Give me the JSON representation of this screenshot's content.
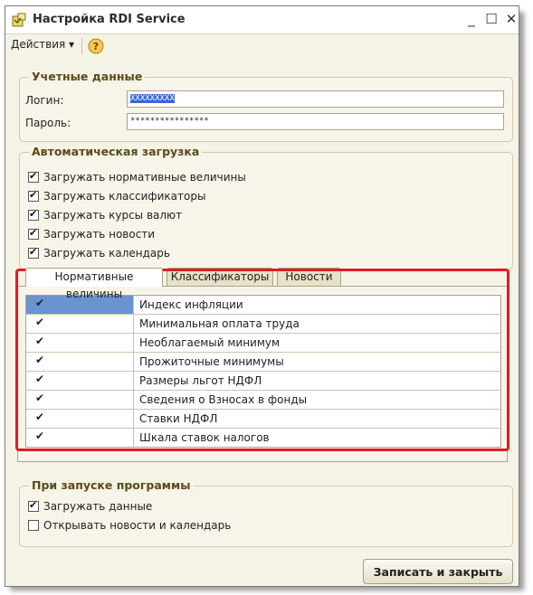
{
  "window": {
    "title": "Настройка RDI Service",
    "minimize": "_",
    "maximize": "☐",
    "close": "✕"
  },
  "toolbar": {
    "actions_label": "Действия ▾",
    "help_glyph": "?"
  },
  "credentials": {
    "title": "Учетные данные",
    "login_label": "Логин:",
    "login_value": "XXXXXXXXX",
    "password_label": "Пароль:",
    "password_value": "****************"
  },
  "autoload": {
    "title": "Автоматическая загрузка",
    "items": [
      {
        "label": "Загружать нормативные величины",
        "checked": true
      },
      {
        "label": "Загружать классификаторы",
        "checked": true
      },
      {
        "label": "Загружать курсы валют",
        "checked": true
      },
      {
        "label": "Загружать новости",
        "checked": true
      },
      {
        "label": "Загружать календарь",
        "checked": true
      }
    ]
  },
  "tabs": [
    {
      "label": "Нормативные величины",
      "active": true
    },
    {
      "label": "Классификаторы",
      "active": false
    },
    {
      "label": "Новости",
      "active": false
    }
  ],
  "table": {
    "check_glyph": "✔",
    "rows": [
      {
        "name": "Индекс инфляции",
        "checked": true
      },
      {
        "name": "Минимальная оплата труда",
        "checked": true
      },
      {
        "name": "Необлагаемый минимум",
        "checked": true
      },
      {
        "name": "Прожиточные минимумы",
        "checked": true
      },
      {
        "name": "Размеры льгот НДФЛ",
        "checked": true
      },
      {
        "name": "Сведения о Взносах в фонды",
        "checked": true
      },
      {
        "name": "Ставки НДФЛ",
        "checked": true
      },
      {
        "name": "Шкала ставок налогов",
        "checked": true
      }
    ]
  },
  "startup": {
    "title": "При запуске программы",
    "items": [
      {
        "label": "Загружать данные",
        "checked": true
      },
      {
        "label": "Открывать новости и календарь",
        "checked": false
      }
    ]
  },
  "save_button": "Записать и закрыть",
  "colors": {
    "highlight_border": "#e41b23",
    "selection": "#6b93cf",
    "group_title": "#5a4a1a"
  }
}
